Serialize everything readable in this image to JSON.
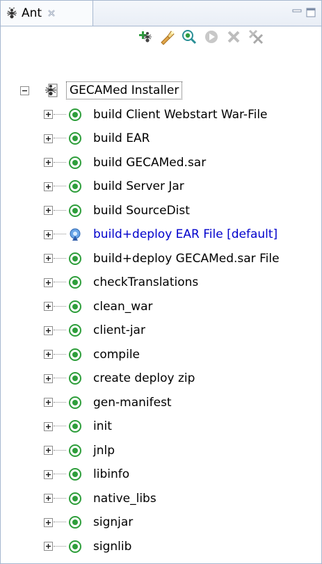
{
  "view": {
    "tab_label": "Ant"
  },
  "toolbar": {
    "buttons": [
      {
        "name": "add-buildfiles-button"
      },
      {
        "name": "search-buildfiles-button"
      },
      {
        "name": "hide-internal-targets-button"
      },
      {
        "name": "run-target-button"
      },
      {
        "name": "remove-buildfile-button"
      },
      {
        "name": "remove-all-buildfiles-button"
      }
    ]
  },
  "tree": {
    "root_label": "GECAMed Installer",
    "targets": [
      {
        "label": "build Client Webstart War-File"
      },
      {
        "label": "build EAR"
      },
      {
        "label": "build GECAMed.sar"
      },
      {
        "label": "build Server Jar"
      },
      {
        "label": "build SourceDist"
      },
      {
        "label": "build+deploy  EAR File [default]",
        "default": true
      },
      {
        "label": "build+deploy  GECAMed.sar File"
      },
      {
        "label": "checkTranslations"
      },
      {
        "label": "clean_war"
      },
      {
        "label": "client-jar"
      },
      {
        "label": "compile"
      },
      {
        "label": "create deploy zip"
      },
      {
        "label": "gen-manifest"
      },
      {
        "label": "init"
      },
      {
        "label": "jnlp"
      },
      {
        "label": "libinfo"
      },
      {
        "label": "native_libs"
      },
      {
        "label": "signjar"
      },
      {
        "label": "signlib"
      }
    ]
  },
  "colors": {
    "border": "#a6b7cf",
    "target_green": "#2e9e3b",
    "default_blue": "#0000cc"
  }
}
